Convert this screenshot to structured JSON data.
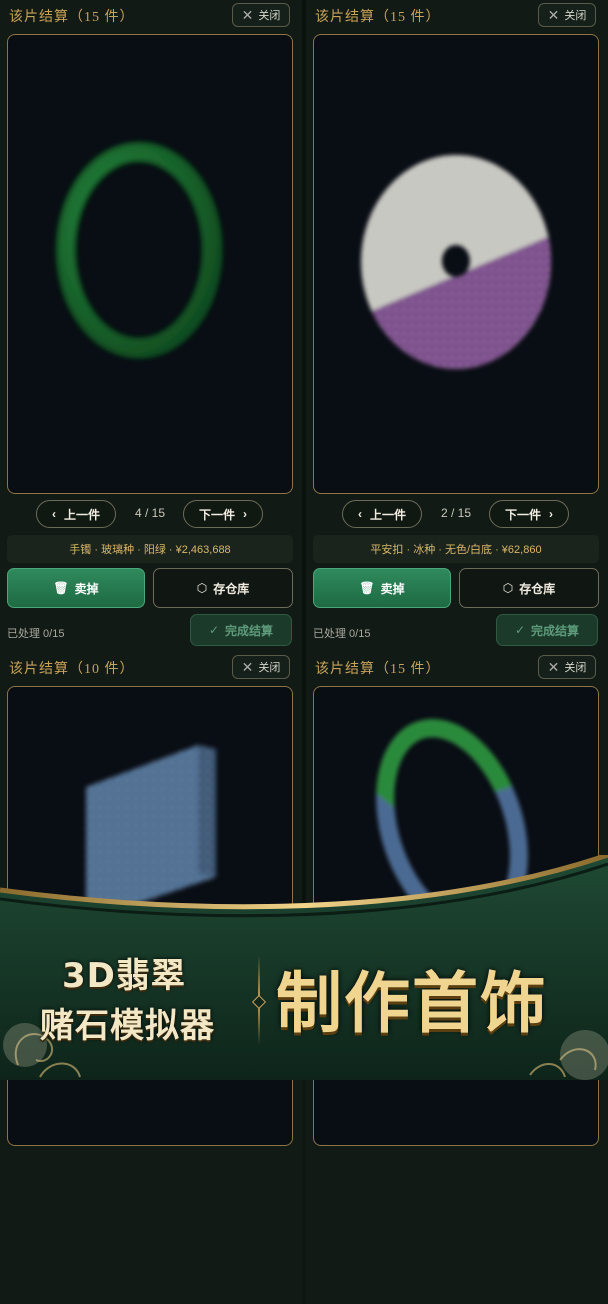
{
  "panels": [
    {
      "title": "该片结算（15 件）",
      "close_label": "关闭",
      "prev_label": "上一件",
      "next_label": "下一件",
      "counter": "4 / 15",
      "info": "手镯 · 玻璃种 · 阳绿 · ¥2,463,688",
      "sell_label": "卖掉",
      "store_label": "存仓库",
      "status": "已处理 0/15",
      "finish_label": "完成结算"
    },
    {
      "title": "该片结算（15 件）",
      "close_label": "关闭",
      "prev_label": "上一件",
      "next_label": "下一件",
      "counter": "2 / 15",
      "info": "平安扣 · 冰种 · 无色/白底 · ¥62,860",
      "sell_label": "卖掉",
      "store_label": "存仓库",
      "status": "已处理 0/15",
      "finish_label": "完成结算"
    },
    {
      "title": "该片结算（10 件）",
      "close_label": "关闭"
    },
    {
      "title": "该片结算（15 件）",
      "close_label": "关闭"
    }
  ],
  "banner": {
    "brand_line1": "3D翡翠",
    "brand_line2": "赌石模拟器",
    "slogan": "制作首饰"
  },
  "icons": {
    "close": "close-icon",
    "prev": "chevron-left-icon",
    "next": "chevron-right-icon",
    "sell": "trash-icon",
    "store": "box-icon",
    "finish": "check-icon"
  },
  "colors": {
    "accent_gold": "#c9a25a",
    "sell_green": "#2f8a5c",
    "jade_green": "#1f7a34",
    "bg_dark": "#111a14"
  }
}
